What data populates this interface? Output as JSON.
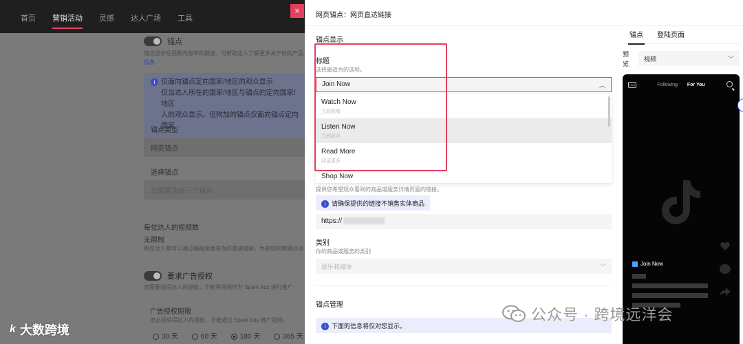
{
  "background": {
    "nav": [
      "首页",
      "营销活动",
      "灵感",
      "达人广场",
      "工具"
    ],
    "active_nav_index": 1,
    "anchor_toggle_label": "锚点",
    "anchor_desc_line1": "锚点显示在视频内容中的链接，可帮助达人了解更多关于你的产品",
    "anchor_desc_link": "信息",
    "info_line1": "仅面向锚点定向国家/地区的观众显示",
    "info_line2": "仅当达人所在的国家/地区与锚点的定向国家/地区",
    "info_line3": "人的观众显示。但附加的锚点仅面向锚点定向国家",
    "anchor_type_label": "锚点类型",
    "anchor_type_value": "网页锚点",
    "select_anchor_label": "选择锚点",
    "select_anchor_placeholder": "您需要选择一个锚点",
    "videos_per_creator_label": "每位达人的视频数",
    "unlimited_label": "无限制",
    "unlimited_desc": "每位达人都可以通过确视频发布你的邀请链接，为参加的营销活动",
    "ad_auth_label": "要求广告授权",
    "ad_auth_desc": "您需要获得达人的授权，才能将视频作为 Spark Ads 进行推广",
    "ad_period_label": "广告授权期限",
    "ad_period_desc": "您必须获得达人的授权，才能通过 Spark Ads 推广视频。",
    "radio_options": [
      "30 天",
      "60 天",
      "180 天",
      "365 天"
    ],
    "radio_selected": 2
  },
  "drawer": {
    "close_symbol": "×",
    "header_title": "网页锚点：网页直达链接",
    "section_anchor_display": "锚点显示",
    "title_label": "标题",
    "title_help": "选择最适合的选项。",
    "selected_value": "Join Now",
    "dropdown_options": [
      {
        "title": "Watch Now",
        "sub": "立即观看"
      },
      {
        "title": "Listen Now",
        "sub": "立即收听"
      },
      {
        "title": "Read More",
        "sub": "阅读更多"
      },
      {
        "title": "Shop Now",
        "sub": ""
      }
    ],
    "hovered_option": 1,
    "url_help": "提供您希望观众看到的商品或服务详情页面的链接。",
    "url_notice": "请确保提供的链接不销售实体商品",
    "url_value": "https://",
    "category_label": "类别",
    "category_help": "你的商品或服务的类别",
    "category_placeholder": "娱乐和媒体",
    "section_anchor_manage": "锚点管理",
    "bottom_notice": "下面的信息将仅对您显示。"
  },
  "preview": {
    "tabs": [
      "锚点",
      "登陆页面"
    ],
    "active_tab": 0,
    "preview_label": "预览",
    "preview_value": "视频",
    "phone_following": "Following",
    "phone_for_you": "For You",
    "phone_live": "LIVE",
    "cta_text": "Join Now"
  },
  "watermarks": {
    "left_text": "大数跨境",
    "left_mark": "k",
    "right_text": "公众号 · 跨境远洋会"
  },
  "colors": {
    "accent": "#e3405f",
    "info_bg": "#eaeefc",
    "info_icon": "#3d4cc9"
  }
}
